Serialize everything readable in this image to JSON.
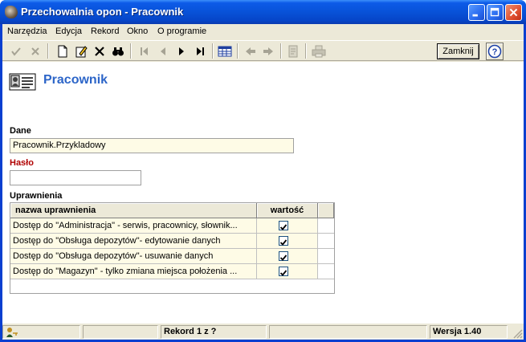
{
  "window": {
    "title": "Przechowalnia opon - Pracownik",
    "icon": "tire-app-icon"
  },
  "menu": [
    "Narzędzia",
    "Edycja",
    "Rekord",
    "Okno",
    "O programie"
  ],
  "toolbar": {
    "close_label": "Zamknij",
    "help_icon": "help-icon"
  },
  "form": {
    "title": "Pracownik",
    "dane_label": "Dane",
    "dane_value": "Pracownik.Przykladowy",
    "haslo_label": "Hasło",
    "haslo_value": "",
    "uprawnienia_label": "Uprawnienia"
  },
  "grid": {
    "columns": [
      "nazwa uprawnienia",
      "wartość"
    ],
    "rows": [
      {
        "name": "Dostęp do \"Administracja\" - serwis, pracownicy, słownik...",
        "checked": true
      },
      {
        "name": "Dostęp do \"Obsługa depozytów\"- edytowanie danych",
        "checked": true
      },
      {
        "name": "Dostęp do \"Obsługa depozytów\"- usuwanie danych",
        "checked": true
      },
      {
        "name": "Dostęp do \"Magazyn\" - tylko zmiana miejsca położenia ...",
        "checked": true
      }
    ]
  },
  "status": {
    "record": "Rekord 1 z ?",
    "version": "Wersja 1.40"
  },
  "colors": {
    "title_blue": "#2c65c8",
    "label_red": "#b00000",
    "field_bg": "#fefbe6"
  }
}
